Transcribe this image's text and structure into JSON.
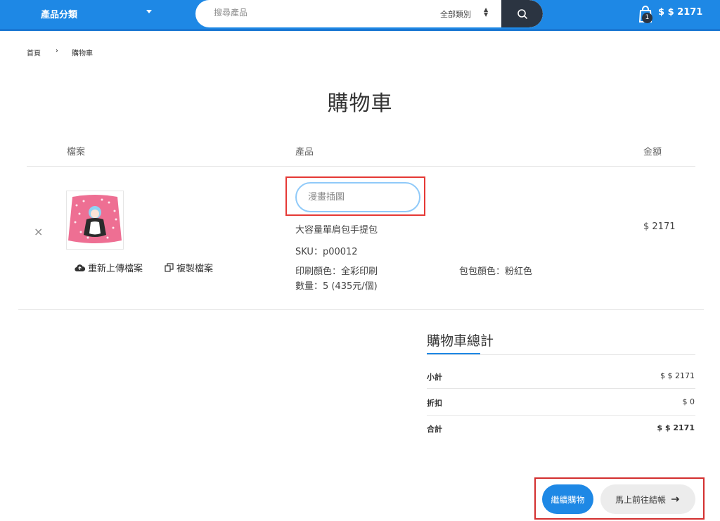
{
  "header": {
    "category_label": "產品分類",
    "search_placeholder": "搜尋產品",
    "search_category": "全部類別",
    "cart_count": "1",
    "cart_total": "$ $ 2171"
  },
  "breadcrumb": {
    "home": "首頁",
    "separator": "›",
    "current": "購物車"
  },
  "page_title": "購物車",
  "table": {
    "col_file": "檔案",
    "col_product": "產品",
    "col_amount": "金額"
  },
  "item": {
    "remove_symbol": "×",
    "reupload_label": "重新上傳檔案",
    "copy_label": "複製檔案",
    "name_placeholder": "漫畫插圖",
    "product_name": "大容量單肩包手提包",
    "sku": "SKU：p00012",
    "print_color": "印刷顏色：全彩印刷",
    "bag_color": "包包顏色：粉紅色",
    "quantity": "數量：5 (435元/個)",
    "price": "$ 2171"
  },
  "totals": {
    "title": "購物車總計",
    "subtotal_label": "小計",
    "subtotal_value": "$ $ 2171",
    "discount_label": "折扣",
    "discount_value": "$ 0",
    "total_label": "合計",
    "total_value": "$ $ 2171"
  },
  "actions": {
    "continue_label": "繼續購物",
    "checkout_label": "馬上前往結帳"
  },
  "colors": {
    "brand": "#1e88e5",
    "dark": "#2b3441",
    "highlight": "#e53935"
  }
}
